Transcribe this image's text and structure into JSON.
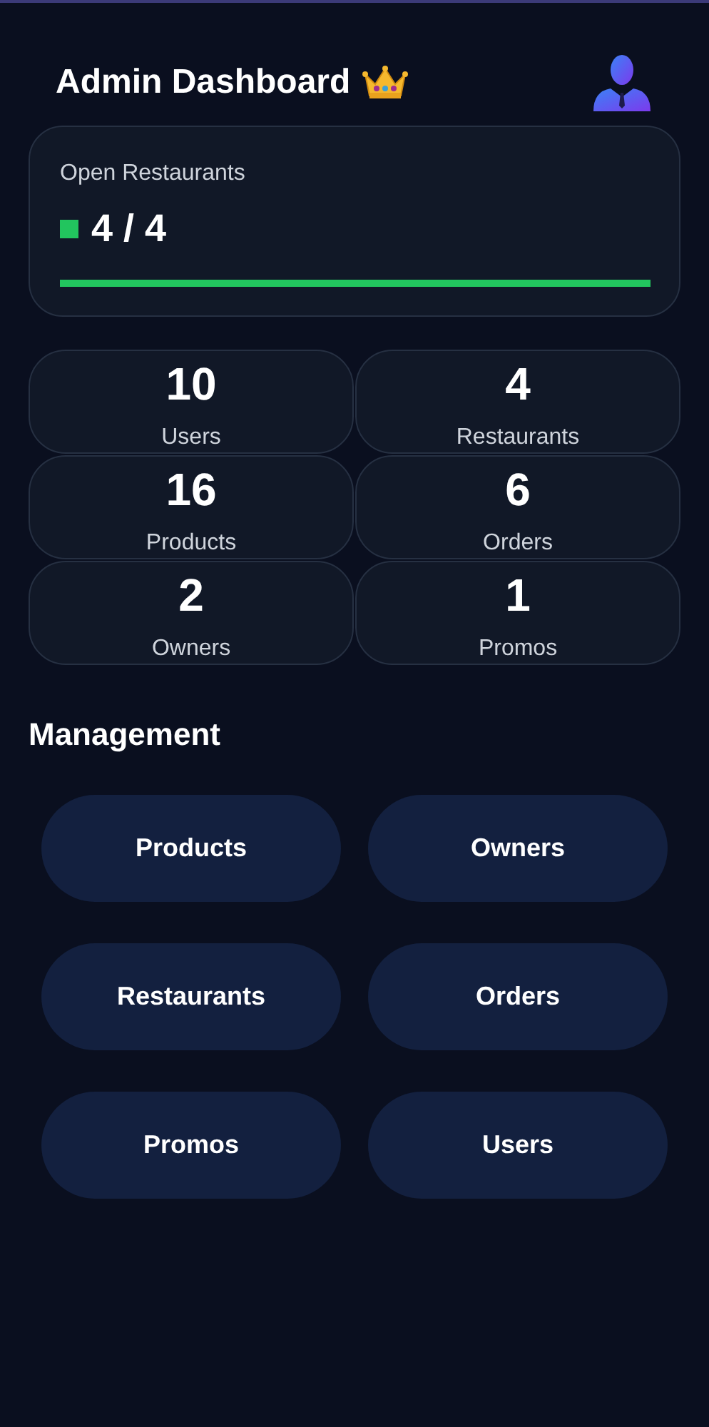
{
  "header": {
    "title": "Admin Dashboard"
  },
  "open_restaurants": {
    "label": "Open Restaurants",
    "value": "4 / 4",
    "level": 1
  },
  "stats": [
    {
      "value": "10",
      "label": "Users"
    },
    {
      "value": "4",
      "label": "Restaurants"
    },
    {
      "value": "16",
      "label": "Products"
    },
    {
      "value": "6",
      "label": "Orders"
    },
    {
      "value": "2",
      "label": "Owners"
    },
    {
      "value": "1",
      "label": "Promos"
    }
  ],
  "management": {
    "title": "Management",
    "buttons": [
      "Products",
      "Owners",
      "Restaurants",
      "Orders",
      "Promos",
      "Users"
    ]
  }
}
